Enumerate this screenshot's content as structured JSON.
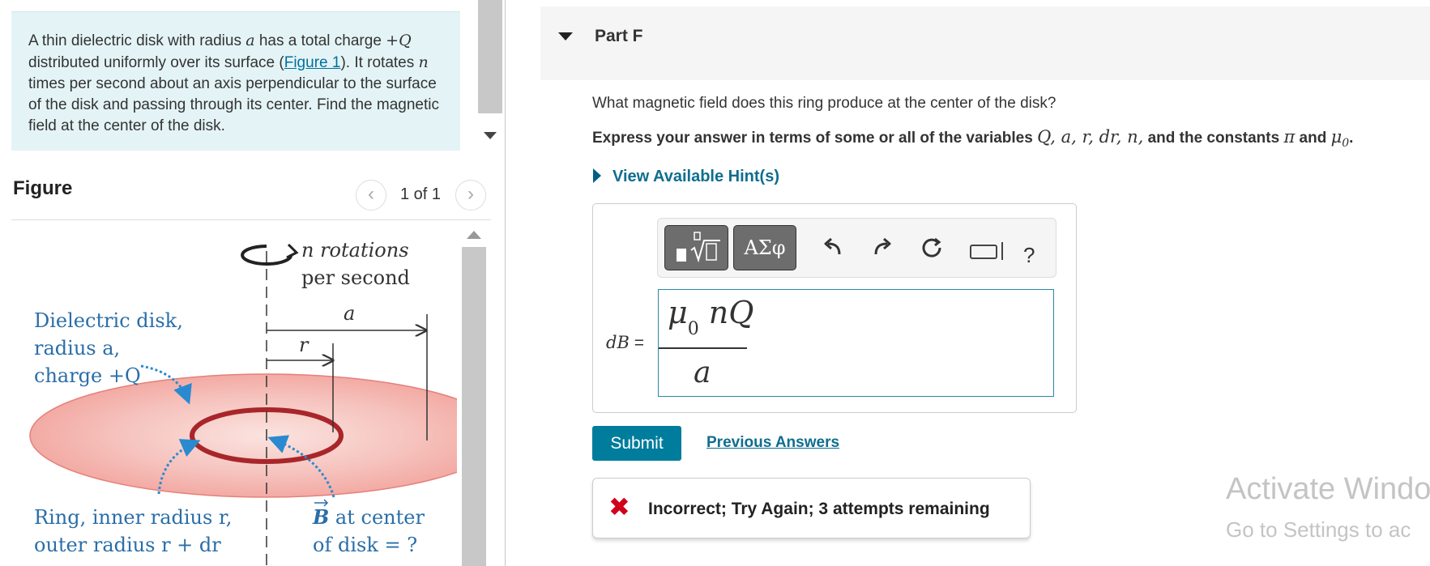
{
  "problem": {
    "text_1": "A thin dielectric disk with radius ",
    "var_a": "a",
    "text_2": " has a total charge ",
    "charge": "+Q",
    "text_3": " distributed uniformly over its surface (",
    "figure_link": "Figure 1",
    "text_4": "). It rotates ",
    "var_n": "n",
    "text_5": " times per second about an axis perpendicular to the surface of the disk and passing through its center. Find the magnetic field at the center of the disk."
  },
  "figure_panel": {
    "title": "Figure",
    "page_count": "1 of 1",
    "prev_icon": "chevron-left-icon",
    "next_icon": "chevron-right-icon",
    "labels": {
      "rotations_1": "n rotations",
      "rotations_2": "per second",
      "a": "a",
      "r": "r",
      "dielectric_1": "Dielectric disk,",
      "dielectric_2": "radius a,",
      "dielectric_3": "charge +Q",
      "ring_1": "Ring, inner radius r,",
      "ring_2": "outer radius r + dr",
      "b_field_b": "B",
      "b_field_1": " at center",
      "b_field_2": "of disk = ?"
    }
  },
  "part": {
    "title": "Part F",
    "question": "What magnetic field does this ring produce at the center of the disk?",
    "instructions_prefix": "Express your answer in terms of some or all of the variables ",
    "instructions_vars": "Q, a, r, dr, n,",
    "instructions_mid": " and the constants ",
    "instructions_consts": "π",
    "instructions_and": " and ",
    "instructions_mu": "μ",
    "instructions_mu_sub": "0",
    "instructions_end": ".",
    "hint_link": "View Available Hint(s)"
  },
  "toolbar": {
    "templates_icon": "templates-icon",
    "greek_label": "ΑΣφ",
    "undo_icon": "undo-icon",
    "redo_icon": "redo-icon",
    "reset_icon": "reset-icon",
    "keyboard_icon": "keyboard-icon",
    "help_label": "?"
  },
  "answer": {
    "label_var": "dB",
    "label_eq": " =",
    "numerator_mu": "μ",
    "numerator_sub": "0",
    "numerator_rest": " nQ",
    "denominator": "a"
  },
  "actions": {
    "submit_label": "Submit",
    "previous_answers": "Previous Answers"
  },
  "feedback": {
    "icon": "x-icon",
    "message": "Incorrect; Try Again; 3 attempts remaining"
  },
  "watermark": {
    "line_1": "Activate Windo",
    "line_2": "Go to Settings to ac"
  },
  "colors": {
    "problem_bg": "#e4f4f6",
    "link": "#0e6e8f",
    "submit_bg": "#007c9c",
    "error": "#d0021b",
    "figure_text": "#2a6ea8",
    "disk_fill": "#f4b9b4",
    "ring_stroke": "#a8262a"
  }
}
